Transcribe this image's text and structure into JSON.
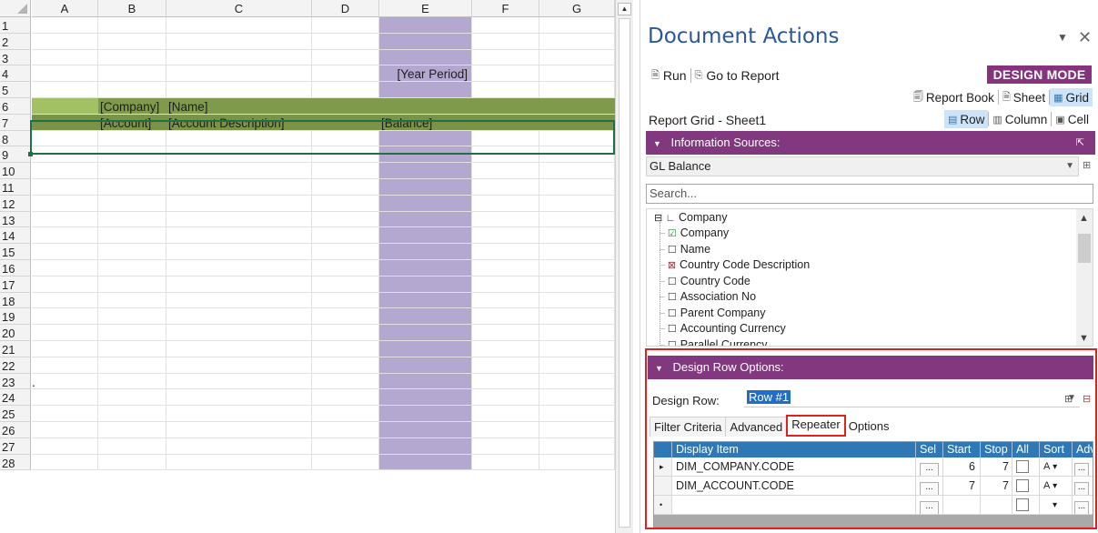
{
  "sheet": {
    "columns": [
      "A",
      "B",
      "C",
      "D",
      "E",
      "F",
      "G"
    ],
    "rows": [
      "1",
      "2",
      "3",
      "4",
      "5",
      "6",
      "7",
      "8",
      "9",
      "10",
      "11",
      "12",
      "13",
      "14",
      "15",
      "16",
      "17",
      "18",
      "19",
      "20",
      "21",
      "22",
      "23",
      "24",
      "25",
      "26",
      "27",
      "28"
    ],
    "cells": {
      "e4": "[Year Period]",
      "b6": "[Company]",
      "c6": "[Name]",
      "b7": "[Account]",
      "c7": "[Account Description]",
      "e7": "[Balance]"
    },
    "stray_mark": ".",
    "colors": {
      "highlight_column": "#b4a7d0",
      "row_band": "#7f9a4b",
      "selection_border": "#1e7145"
    }
  },
  "pane": {
    "title": "Document Actions",
    "dropdown_icon": "chevron-down-icon",
    "close_icon": "close-icon",
    "toolbar": {
      "run": "Run",
      "go_to_report": "Go to Report",
      "design_mode": "DESIGN MODE",
      "report_book": "Report Book",
      "sheet": "Sheet",
      "grid": "Grid"
    },
    "report_grid_title": "Report Grid - Sheet1",
    "scope": {
      "row": "Row",
      "column": "Column",
      "cell": "Cell"
    },
    "info_sources": {
      "header": "Information Sources:",
      "selected": "GL Balance",
      "search_placeholder": "Search...",
      "tree_root": "Company",
      "tree_items": [
        {
          "label": "Company",
          "mark": "☑"
        },
        {
          "label": "Name",
          "mark": "☐"
        },
        {
          "label": "Country Code Description",
          "mark": "⊠"
        },
        {
          "label": "Country Code",
          "mark": "☐"
        },
        {
          "label": "Association No",
          "mark": "☐"
        },
        {
          "label": "Parent Company",
          "mark": "☐"
        },
        {
          "label": "Accounting Currency",
          "mark": "☐"
        },
        {
          "label": "Parallel Currency",
          "mark": "☐"
        }
      ]
    },
    "design_row": {
      "header": "Design Row Options:",
      "label": "Design Row:",
      "value": "Row #1",
      "tabs": [
        "Filter Criteria",
        "Advanced",
        "Repeater",
        "Options"
      ],
      "active_tab": "Repeater",
      "grid": {
        "headers": [
          "Display Item",
          "Sel",
          "Start",
          "Stop",
          "All",
          "Sort",
          "Adv"
        ],
        "rows": [
          {
            "display_item": "DIM_COMPANY.CODE",
            "sel": "...",
            "start": "6",
            "stop": "7",
            "sort": "A",
            "adv": "..."
          },
          {
            "display_item": "DIM_ACCOUNT.CODE",
            "sel": "...",
            "start": "7",
            "stop": "7",
            "sort": "A",
            "adv": "..."
          },
          {
            "display_item": "",
            "sel": "...",
            "start": "",
            "stop": "",
            "sort": "",
            "adv": "..."
          }
        ]
      }
    },
    "colors": {
      "title": "#2b5797",
      "accent_purple": "#82387e",
      "design_mode": "#85337f",
      "grid_header": "#2f77b5",
      "highlight_frame": "#e0201f"
    }
  }
}
